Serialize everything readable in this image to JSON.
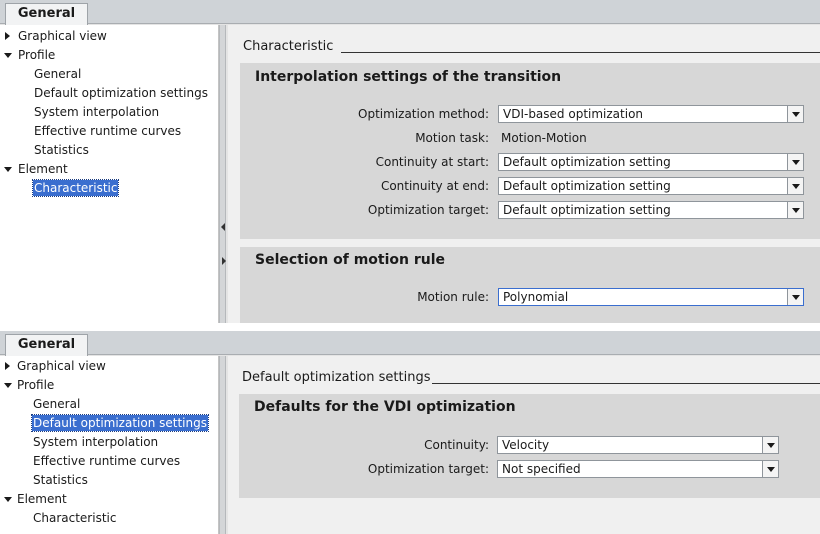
{
  "panels": [
    {
      "tab_label": "General",
      "tree": [
        {
          "label": "Graphical view",
          "level": 0,
          "toggle": "collapsed",
          "selected": false
        },
        {
          "label": "Profile",
          "level": 0,
          "toggle": "expanded",
          "selected": false
        },
        {
          "label": "General",
          "level": 1,
          "toggle": "none",
          "selected": false
        },
        {
          "label": "Default optimization settings",
          "level": 1,
          "toggle": "none",
          "selected": false
        },
        {
          "label": "System interpolation",
          "level": 1,
          "toggle": "none",
          "selected": false
        },
        {
          "label": "Effective runtime curves",
          "level": 1,
          "toggle": "none",
          "selected": false
        },
        {
          "label": "Statistics",
          "level": 1,
          "toggle": "none",
          "selected": false
        },
        {
          "label": "Element",
          "level": 0,
          "toggle": "expanded",
          "selected": false
        },
        {
          "label": "Characteristic",
          "level": 1,
          "toggle": "none",
          "selected": true
        }
      ],
      "section_heading": "Characteristic",
      "groups": [
        {
          "title": "Interpolation settings of the transition",
          "rows": [
            {
              "label": "Optimization method:",
              "value": "VDI-based optimization",
              "kind": "combo"
            },
            {
              "label": "Motion task:",
              "value": "Motion-Motion",
              "kind": "text"
            },
            {
              "label": "Continuity at start:",
              "value": "Default optimization setting",
              "kind": "combo"
            },
            {
              "label": "Continuity at end:",
              "value": "Default optimization setting",
              "kind": "combo"
            },
            {
              "label": "Optimization target:",
              "value": "Default optimization setting",
              "kind": "combo"
            }
          ]
        },
        {
          "title": "Selection of motion rule",
          "rows": [
            {
              "label": "Motion rule:",
              "value": "Polynomial",
              "kind": "combo"
            }
          ]
        }
      ]
    },
    {
      "tab_label": "General",
      "tree": [
        {
          "label": "Graphical view",
          "level": 0,
          "toggle": "collapsed",
          "selected": false
        },
        {
          "label": "Profile",
          "level": 0,
          "toggle": "expanded",
          "selected": false
        },
        {
          "label": "General",
          "level": 1,
          "toggle": "none",
          "selected": false
        },
        {
          "label": "Default optimization settings",
          "level": 1,
          "toggle": "none",
          "selected": true
        },
        {
          "label": "System interpolation",
          "level": 1,
          "toggle": "none",
          "selected": false
        },
        {
          "label": "Effective runtime curves",
          "level": 1,
          "toggle": "none",
          "selected": false
        },
        {
          "label": "Statistics",
          "level": 1,
          "toggle": "none",
          "selected": false
        },
        {
          "label": "Element",
          "level": 0,
          "toggle": "expanded",
          "selected": false
        },
        {
          "label": "Characteristic",
          "level": 1,
          "toggle": "none",
          "selected": false
        }
      ],
      "section_heading": "Default optimization settings",
      "groups": [
        {
          "title": "Defaults for the VDI optimization",
          "rows": [
            {
              "label": "Continuity:",
              "value": "Velocity",
              "kind": "combo"
            },
            {
              "label": "Optimization target:",
              "value": "Not specified",
              "kind": "combo"
            }
          ]
        }
      ]
    }
  ]
}
